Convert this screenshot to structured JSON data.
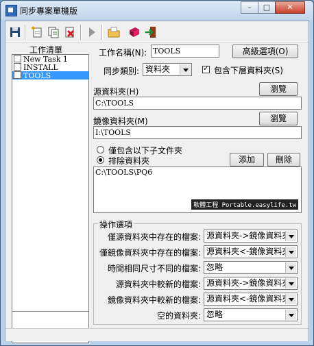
{
  "window": {
    "title": "同步專案單機版"
  },
  "toolbar": {
    "icons": [
      "save-icon",
      "new-task-icon",
      "copy-task-icon",
      "delete-task-icon",
      "run-icon",
      "open-folder-icon",
      "books-icon",
      "exit-icon"
    ]
  },
  "task_list": {
    "label": "工作清單",
    "items": [
      {
        "label": "New Task 1",
        "selected": false
      },
      {
        "label": "INSTALL",
        "selected": false
      },
      {
        "label": "TOOLS",
        "selected": true
      }
    ]
  },
  "task_name": {
    "label": "工作名稱(N):",
    "value": "TOOLS"
  },
  "advanced_button": "高級選項(O)",
  "sync_type": {
    "label": "同步類別:",
    "value": "資料夾"
  },
  "include_subfolders": {
    "label": "包含下層資料夾(S)",
    "checked": true
  },
  "source_folder": {
    "label": "源資料夾(H)",
    "value": "C:\\TOOLS",
    "browse": "瀏覽"
  },
  "mirror_folder": {
    "label": "鏡像資料夾(M)",
    "value": "I:\\TOOLS",
    "browse": "瀏覽"
  },
  "filter": {
    "include_only": {
      "label": "僅包含以下子文件夾",
      "checked": false
    },
    "exclude": {
      "label": "排除資料夾",
      "checked": true
    },
    "add_button": "添加",
    "delete_button": "刪除",
    "entries": [
      "C:\\TOOLS\\PQ6"
    ],
    "watermark": "軟體工程 Portable.easylife.tw"
  },
  "operations": {
    "title": "操作選項",
    "rows": [
      {
        "label": "僅源資料夾中存在的檔案:",
        "value": "源資料夾->鏡像資料夾"
      },
      {
        "label": "僅鏡像資料夾中存在的檔案:",
        "value": "源資料夾<-鏡像資料夾"
      },
      {
        "label": "時間相同尺寸不同的檔案:",
        "value": "忽略"
      },
      {
        "label": "源資料夾中較新的檔案:",
        "value": "源資料夾->鏡像資料夾"
      },
      {
        "label": "鏡像資料夾中較新的檔案:",
        "value": "源資料夾<-鏡像資料夾"
      },
      {
        "label": "空的資料夾:",
        "value": "忽略"
      }
    ]
  },
  "colors": {
    "selection": "#3399ff",
    "titlebar": "#c3d7ec",
    "client": "#f0f0f0"
  }
}
